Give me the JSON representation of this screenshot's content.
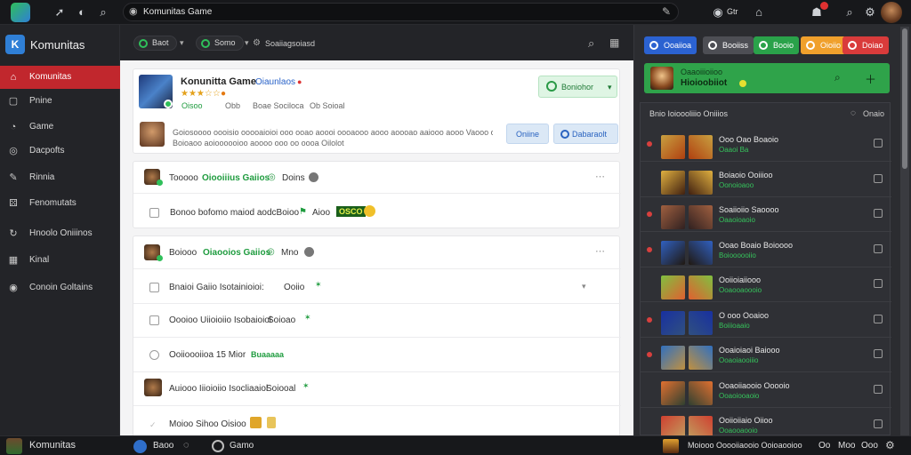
{
  "browser": {
    "tab_title": "Komunitas Game"
  },
  "sidebar": {
    "app_name": "Komunitas",
    "items": [
      {
        "label": "Komunitas",
        "icon": "home-icon",
        "active": true
      },
      {
        "label": "Pnine",
        "icon": "square-icon",
        "active": false
      },
      {
        "label": "Game",
        "icon": "gamepad-icon",
        "active": false
      },
      {
        "label": "Dacpofts",
        "icon": "circle-icon",
        "active": false
      },
      {
        "label": "Rinnia",
        "icon": "pen-icon",
        "active": false
      },
      {
        "label": "Fenomutats",
        "icon": "puzzle-icon",
        "active": false
      },
      {
        "label": "Hnoolo Oniiinos",
        "icon": "refresh-icon",
        "active": false
      },
      {
        "label": "Kinal",
        "icon": "grid-icon",
        "active": false
      },
      {
        "label": "Conoin Goltains",
        "icon": "target-icon",
        "active": false
      }
    ]
  },
  "subheader": {
    "chip1": "Baot",
    "chip2": "Somo",
    "chip3": "Soaiiagsoiasd"
  },
  "post": {
    "title": "Konunitta Game",
    "title_link": "Oiaunlaos",
    "rating": "★★★☆☆",
    "meta1": "Oisoo",
    "meta2": "Obb",
    "meta3": "Boae Sociloca",
    "meta4": "Ob Soioal",
    "follow_button": "Boniohor",
    "comment_text": "Goiosoooo oooisio ooooaioioi ooo ooao aoooi oooaooo aooo aoooao aaiooo aooo Vaooo ooaao",
    "comment_text2": "Boioaoo aoioooooioo aoooo ooo oo oooa Oilolot",
    "btn_online": "Oniine",
    "btn_detail": "Dabaraolt"
  },
  "thread1": {
    "user": "Tooooo",
    "group": "Oiooiiius Gaiios",
    "status": "Doins",
    "item_text": "Bonoo bofomo maiod aodcBoioo",
    "item_suffix": "Aioo",
    "badge": "OSCO"
  },
  "thread2": {
    "user": "Boiooo",
    "group": "Oiaooios Gaiios",
    "status": "Mno",
    "items": [
      {
        "text": "Bnaioi Gaiio Isotainioioi:",
        "suffix": "Ooiio"
      },
      {
        "text": "Oooioo Uiioioiio Isobaioiol",
        "suffix": "Soioao"
      },
      {
        "text": "Ooiioooiioa 15 Mior",
        "suffix": "Buaaaaa"
      },
      {
        "text": "Auiooo Iiioioiio Isocliaaiol",
        "suffix": "Soiooal"
      },
      {
        "text": "Moioo Sihoo Oisioo",
        "suffix": ""
      }
    ]
  },
  "right": {
    "tabs": [
      {
        "label": "Ooaiioa",
        "color": "#2b62d1"
      },
      {
        "label": "Booiiss",
        "color": "#4d4e54"
      },
      {
        "label": "Booio",
        "color": "#2aa24a"
      },
      {
        "label": "Oioiio",
        "color": "#f0a02c"
      },
      {
        "label": "Doiao",
        "color": "#d93b3b"
      }
    ],
    "group_name": "Oaaoiiioiioo",
    "group_sub": "Hioioobiiot",
    "panel_title": "Bnio Ioioooliiio Oniiios",
    "panel_action": "Onaio",
    "friends": [
      {
        "name": "Ooo Oao Boaoio",
        "status": "Oaaoi Ba",
        "dot": true
      },
      {
        "name": "Boiaoio Ooiiioo",
        "status": "Oonoioaoo",
        "dot": false
      },
      {
        "name": "Soaiioiio Saoooo",
        "status": "Oaaoioaoio",
        "dot": true
      },
      {
        "name": "Ooao Boaio Boioooo",
        "status": "Boioooooiio",
        "dot": true
      },
      {
        "name": "Ooiioiaiiooo",
        "status": "Ooaooaoooio",
        "dot": false
      },
      {
        "name": "O ooo Ooaioo",
        "status": "Boiiioaaio",
        "dot": true
      },
      {
        "name": "Ooaioiaoi Baiooo",
        "status": "Ooaoiaooiiio",
        "dot": true
      },
      {
        "name": "Ooaoiiaooio Ooooio",
        "status": "Ooaoiooaoio",
        "dot": false
      },
      {
        "name": "Ooiioiiaio Oiioo",
        "status": "Ooaooaooio",
        "dot": false
      }
    ]
  },
  "bottombar": {
    "name": "Komunitas",
    "item1": "Baoo",
    "item2": "Gamo",
    "friend_info": "Moiooo Ooooiiaooio Ooioaooioo",
    "r1": "Oo",
    "r2": "Moo",
    "r3": "Ooo"
  }
}
